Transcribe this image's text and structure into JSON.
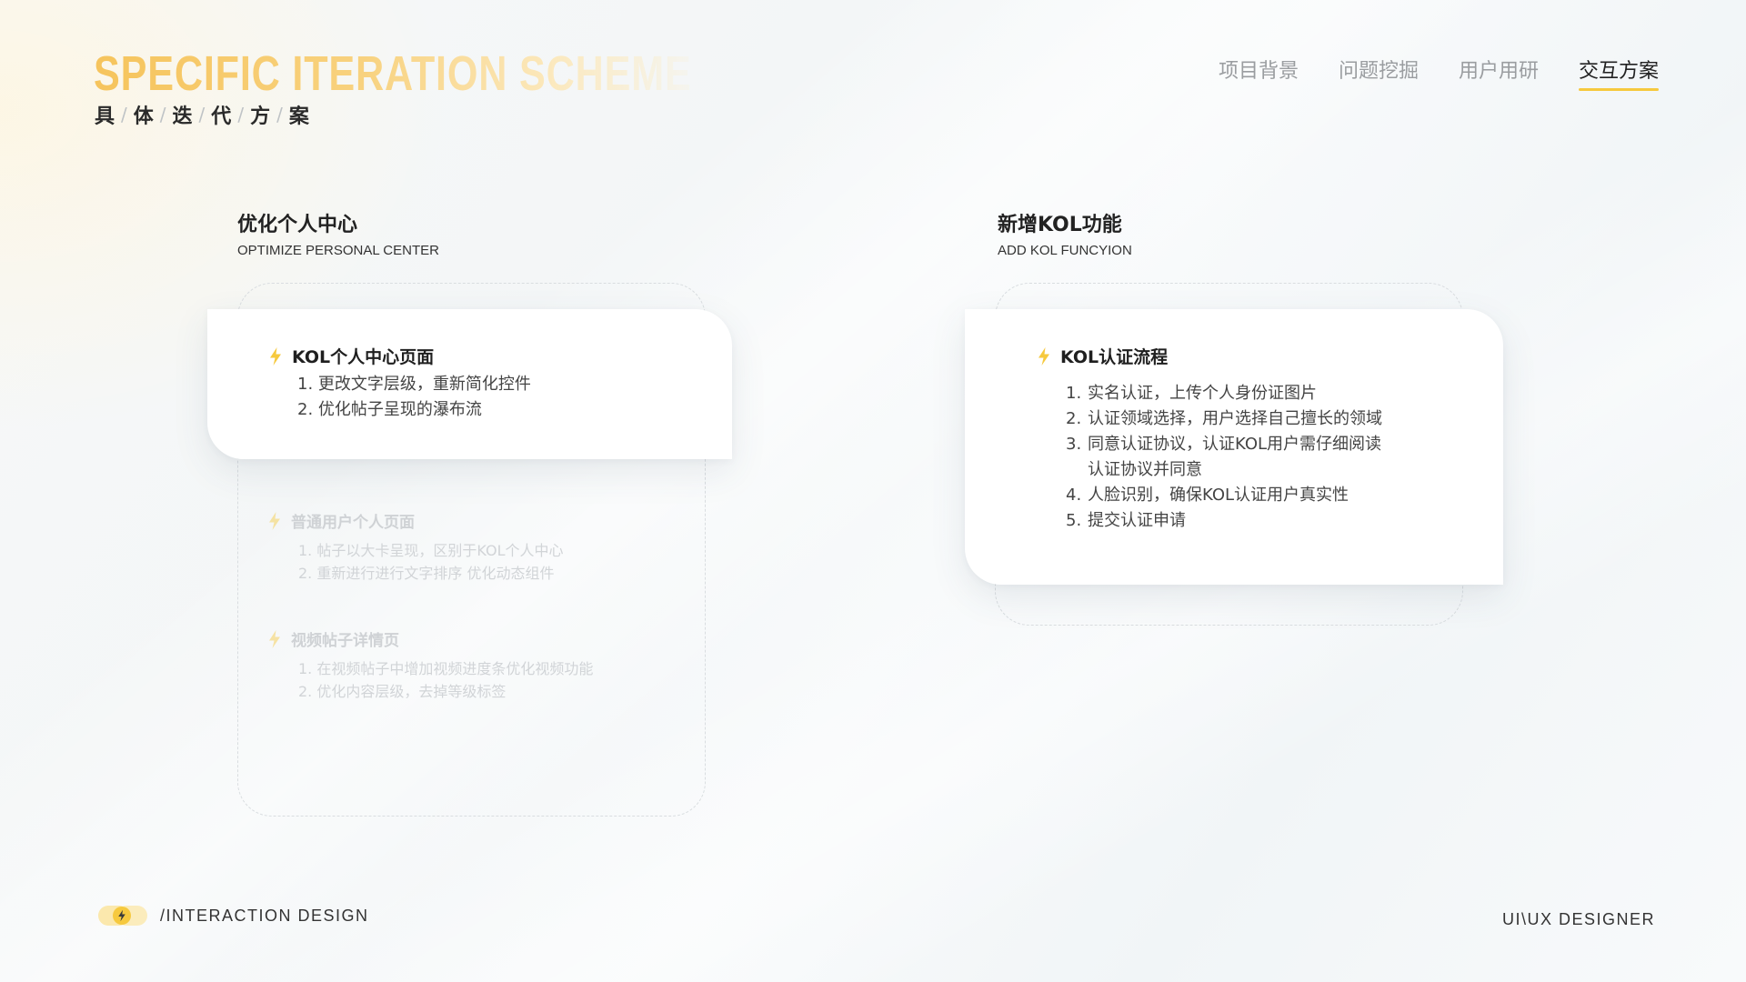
{
  "header": {
    "title_en": "SPECIFIC ITERATION SCHEME",
    "subtitle_chars": [
      "具",
      "体",
      "迭",
      "代",
      "方",
      "案"
    ],
    "separator": "/"
  },
  "nav": {
    "items": [
      {
        "label": "项目背景"
      },
      {
        "label": "问题挖掘"
      },
      {
        "label": "用户用研"
      },
      {
        "label": "交互方案"
      }
    ],
    "active_index": 3
  },
  "left_section": {
    "title_zh": "优化个人中心",
    "title_en": "OPTIMIZE PERSONAL CENTER",
    "card": {
      "title": "KOL个人中心页面",
      "items": [
        "1. 更改文字层级，重新简化控件",
        "2. 优化帖子呈现的瀑布流"
      ]
    },
    "faded_items": [
      {
        "title": "普通用户个人页面",
        "items": [
          "1. 帖子以大卡呈现，区别于KOL个人中心",
          "2. 重新进行进行文字排序 优化动态组件"
        ]
      },
      {
        "title": "视频帖子详情页",
        "items": [
          "1. 在视频帖子中增加视频进度条优化视频功能",
          "2. 优化内容层级，去掉等级标签"
        ]
      }
    ]
  },
  "right_section": {
    "title_zh": "新增KOL功能",
    "title_en": "ADD KOL FUNCYION",
    "card": {
      "title": "KOL认证流程",
      "items": [
        {
          "num": "1.",
          "text": "实名认证，上传个人身份证图片"
        },
        {
          "num": "2.",
          "text": "认证领域选择，用户选择自己擅长的领域"
        },
        {
          "num": "3.",
          "text": "同意认证协议，认证KOL用户需仔细阅读"
        },
        {
          "num": "",
          "text": "认证协议并同意"
        },
        {
          "num": "4.",
          "text": "人脸识别，确保KOL认证用户真实性"
        },
        {
          "num": "5.",
          "text": "提交认证申请"
        }
      ]
    }
  },
  "footer": {
    "left_text": "/INTERACTION DESIGN",
    "right_text": "UI\\UX DESIGNER"
  },
  "colors": {
    "accent": "#f6c93e",
    "title_gradient_start": "#f6c45c",
    "title_gradient_end": "#fbe7b9"
  },
  "icons": {
    "bullet": "lightning-bolt-icon",
    "footer_badge": "lightning-badge-icon"
  }
}
